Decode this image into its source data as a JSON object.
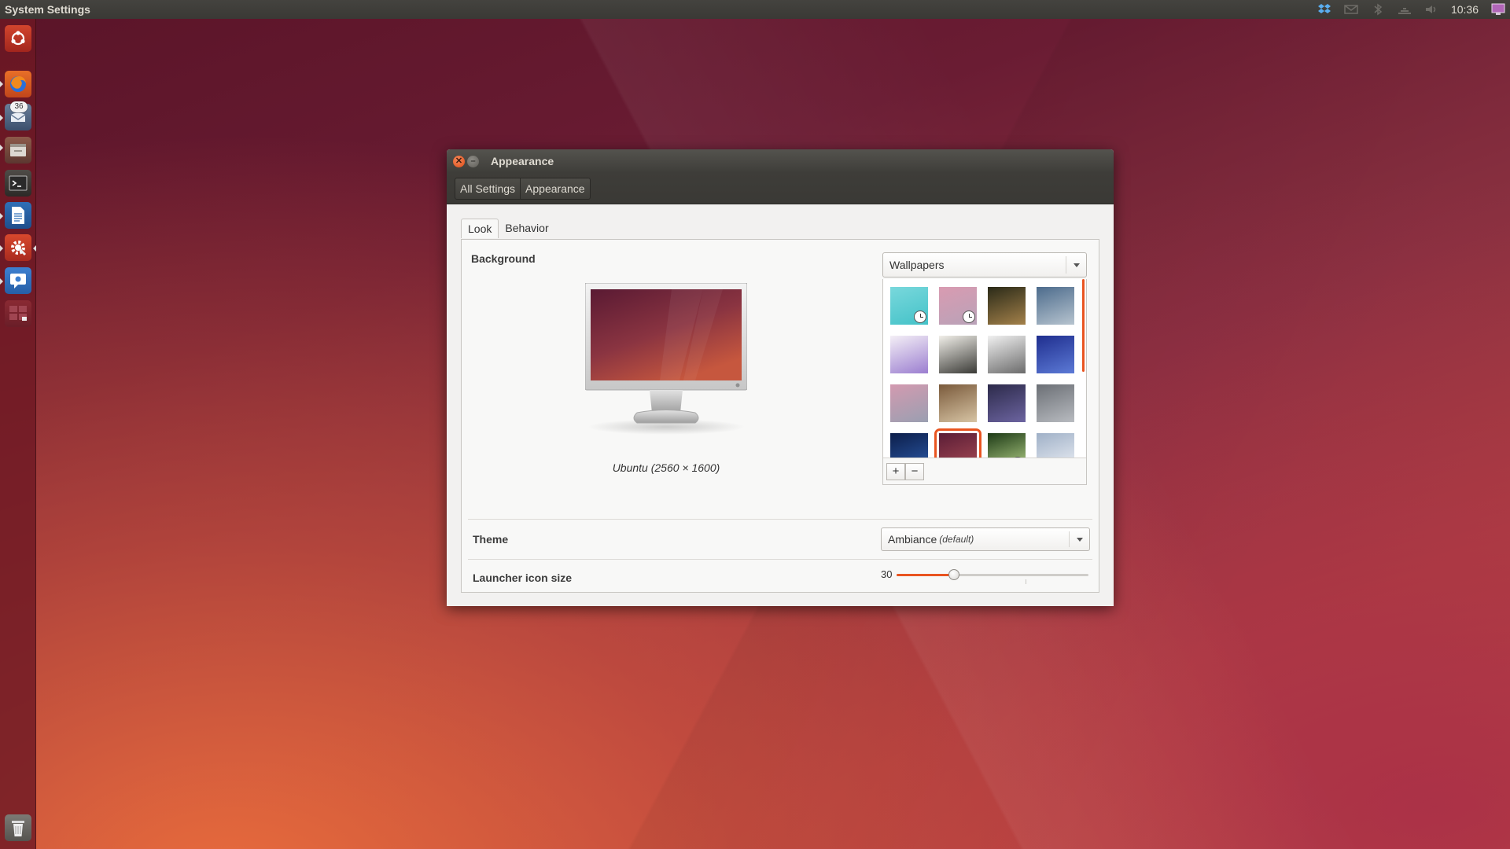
{
  "panel": {
    "app_title": "System Settings",
    "clock": "10:36",
    "indicators": [
      "dropbox-icon",
      "mail-tray-icon",
      "bluetooth-icon",
      "network-icon",
      "volume-icon",
      "session-icon"
    ]
  },
  "launcher": {
    "items": [
      {
        "name": "dash-home",
        "icon": "ubuntu-logo-icon"
      },
      {
        "name": "firefox",
        "icon": "firefox-icon"
      },
      {
        "name": "mail-client",
        "icon": "mail-client-icon",
        "badge": "36"
      },
      {
        "name": "files",
        "icon": "file-manager-icon"
      },
      {
        "name": "terminal",
        "icon": "terminal-icon"
      },
      {
        "name": "writer",
        "icon": "document-icon"
      },
      {
        "name": "system-settings",
        "icon": "settings-icon"
      },
      {
        "name": "messaging",
        "icon": "chat-icon"
      },
      {
        "name": "workspaces",
        "icon": "workspace-switcher-icon"
      },
      {
        "name": "trash",
        "icon": "trash-icon"
      }
    ]
  },
  "window": {
    "title": "Appearance",
    "breadcrumb": [
      "All Settings",
      "Appearance"
    ],
    "tabs": [
      "Look",
      "Behavior"
    ],
    "active_tab": "Look",
    "background": {
      "label": "Background",
      "source": "Wallpapers",
      "preview_caption": "Ubuntu (2560 × 1600)",
      "add_label": "+",
      "remove_label": "−",
      "wallpapers": [
        {
          "colors": [
            "#79d8dc",
            "#44c2c8"
          ],
          "slideshow": true
        },
        {
          "colors": [
            "#d99bb1",
            "#b9a2b8"
          ],
          "slideshow": true
        },
        {
          "colors": [
            "#2a2a18",
            "#a4814a"
          ],
          "slideshow": false
        },
        {
          "colors": [
            "#4c6b8c",
            "#b7c4cf"
          ],
          "slideshow": false
        },
        {
          "colors": [
            "#f4eff6",
            "#9b7ed0"
          ],
          "slideshow": false
        },
        {
          "colors": [
            "#f2f0ea",
            "#3a3a36"
          ],
          "slideshow": false
        },
        {
          "colors": [
            "#f1f1f1",
            "#6b6b6b"
          ],
          "slideshow": false
        },
        {
          "colors": [
            "#1f2e8e",
            "#5c7ad6"
          ],
          "slideshow": false
        },
        {
          "colors": [
            "#d39ab0",
            "#9a9fb1"
          ],
          "slideshow": false
        },
        {
          "colors": [
            "#7a5a3b",
            "#d7c4a4"
          ],
          "slideshow": false
        },
        {
          "colors": [
            "#2c2a4a",
            "#6c64a0"
          ],
          "slideshow": false
        },
        {
          "colors": [
            "#6b6f75",
            "#b8bbc0"
          ],
          "slideshow": false
        },
        {
          "colors": [
            "#0c1e4a",
            "#2c5aa8"
          ],
          "slideshow": false
        },
        {
          "colors": [
            "#5a1d36",
            "#a84b55"
          ],
          "slideshow": false,
          "selected": true
        },
        {
          "colors": [
            "#1d3a16",
            "#b7d48a"
          ],
          "slideshow": true
        },
        {
          "colors": [
            "#9fb0c7",
            "#eef1f6"
          ],
          "slideshow": false
        }
      ]
    },
    "theme": {
      "label": "Theme",
      "value": "Ambiance",
      "value_note": "(default)"
    },
    "launcher_size": {
      "label": "Launcher icon size",
      "value": "30",
      "fraction": 0.3
    }
  }
}
